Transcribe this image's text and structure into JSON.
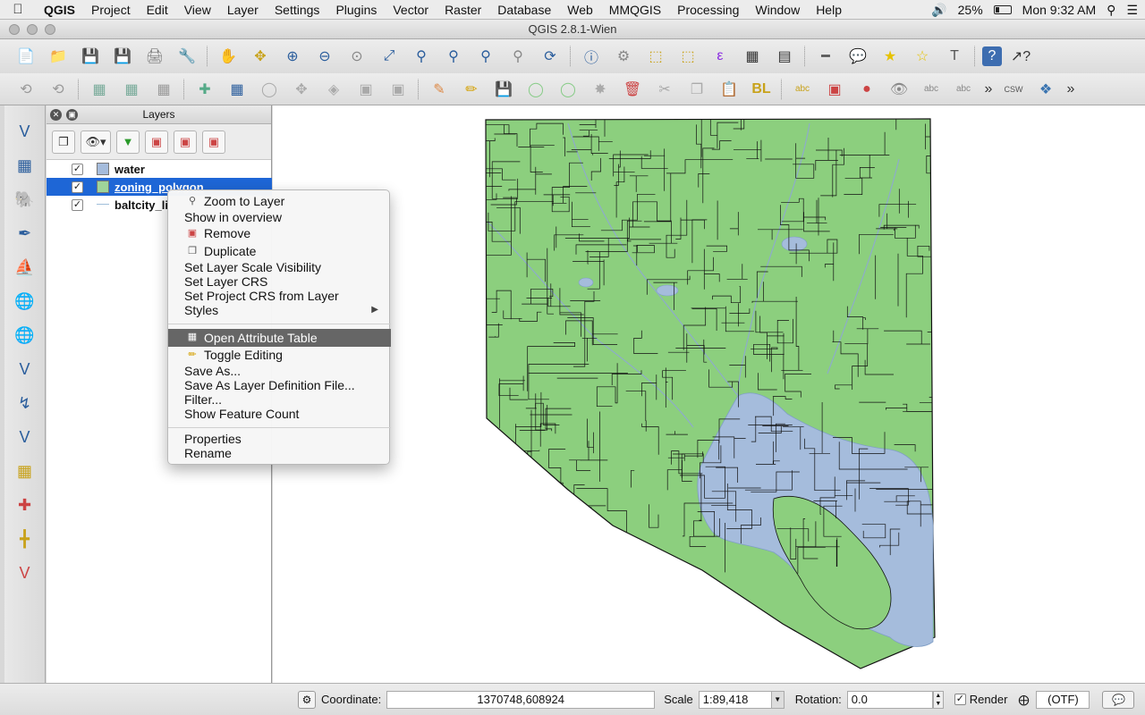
{
  "menubar": {
    "items": [
      "QGIS",
      "Project",
      "Edit",
      "View",
      "Layer",
      "Settings",
      "Plugins",
      "Vector",
      "Raster",
      "Database",
      "Web",
      "MMQGIS",
      "Processing",
      "Window",
      "Help"
    ],
    "battery": "25%",
    "clock": "Mon 9:32 AM"
  },
  "window": {
    "title": "QGIS 2.8.1-Wien"
  },
  "toolbar1_icons": [
    "new-project",
    "open-project",
    "save-project",
    "save-as",
    "new-print-composer",
    "composer-manager",
    "pan",
    "pan-to-selection",
    "zoom-in",
    "zoom-out",
    "zoom-actual",
    "zoom-full",
    "zoom-to-selection",
    "zoom-to-layer",
    "zoom-last",
    "zoom-next",
    "refresh",
    "identify",
    "actions",
    "select",
    "deselect",
    "expression-select",
    "attribute-table",
    "field-calculator",
    "measure",
    "annotation",
    "map-tips",
    "new-bookmark",
    "bookmarks",
    "text-annotation",
    "help",
    "whats-this"
  ],
  "toolbar2_icons": [
    "current-edits",
    "toggle-editing",
    "save-edits",
    "add-feature",
    "move-feature",
    "node-tool",
    "delete-selected",
    "cut",
    "copy",
    "paste",
    "layer-labeling",
    "label-pin",
    "label-show",
    "label-move",
    "label-rotate",
    "label-change",
    "csw",
    "python"
  ],
  "layers_panel": {
    "title": "Layers",
    "layers": [
      {
        "name": "water",
        "checked": true,
        "swatch": "#a5bcdc",
        "selected": false
      },
      {
        "name": "zoning_polygon",
        "checked": true,
        "swatch": "#9fd49a",
        "selected": true
      },
      {
        "name": "baltcity_li",
        "checked": true,
        "swatch": "line",
        "selected": false
      }
    ]
  },
  "context_menu": {
    "items": [
      {
        "label": "Zoom to Layer",
        "icon": "zoom-layer-icon"
      },
      {
        "label": "Show in overview"
      },
      {
        "label": "Remove",
        "icon": "remove-icon"
      },
      {
        "label": "Duplicate",
        "icon": "duplicate-icon"
      },
      {
        "label": "Set Layer Scale Visibility"
      },
      {
        "label": "Set Layer CRS"
      },
      {
        "label": "Set Project CRS from Layer"
      },
      {
        "label": "Styles",
        "submenu": true
      },
      {
        "label": "Open Attribute Table",
        "icon": "table-icon",
        "highlighted": true
      },
      {
        "label": "Toggle Editing",
        "icon": "pencil-icon"
      },
      {
        "label": "Save As..."
      },
      {
        "label": "Save As Layer Definition File..."
      },
      {
        "label": "Filter..."
      },
      {
        "label": "Show Feature Count"
      },
      {
        "label": "Properties"
      },
      {
        "label": "Rename"
      }
    ]
  },
  "statusbar": {
    "coordinate_label": "Coordinate:",
    "coordinate_value": "1370748,608924",
    "scale_label": "Scale",
    "scale_value": "1:89,418",
    "rotation_label": "Rotation:",
    "rotation_value": "0.0",
    "render_label": "Render",
    "render_checked": true,
    "crs_label": "(OTF)"
  },
  "colors": {
    "land": "#8ccf7e",
    "water": "#a5bcdc",
    "boundary": "#111111",
    "selection": "#1e66d6",
    "menu_highlight": "#666666"
  }
}
